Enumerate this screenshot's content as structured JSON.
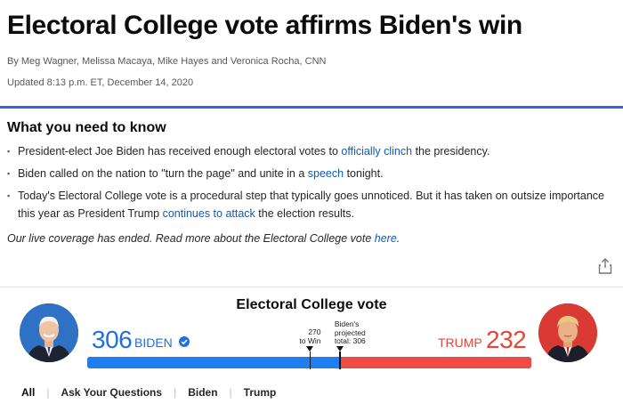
{
  "article": {
    "headline": "Electoral College vote affirms Biden's win",
    "byline": "By Meg Wagner, Melissa Macaya, Mike Hayes and Veronica Rocha, CNN",
    "updated": "Updated 8:13 p.m. ET, December 14, 2020"
  },
  "need_to_know": {
    "title": "What you need to know",
    "points": [
      {
        "before": "President-elect Joe Biden has received enough electoral votes to ",
        "link": "officially clinch",
        "after": " the presidency."
      },
      {
        "before": "Biden called on the nation to \"turn the page\" and unite in a ",
        "link": "speech",
        "after": " tonight."
      },
      {
        "before": "Today's Electoral College vote is a procedural step that typically goes unnoticed. But it has taken on outsize importance this year as President Trump ",
        "link": "continues to attack",
        "after": " the election results."
      }
    ],
    "coverage_before": "Our live coverage has ended. Read more about the Electoral College vote ",
    "coverage_link": "here",
    "coverage_after": "."
  },
  "electoral": {
    "title": "Electoral College vote",
    "total": 538,
    "biden": {
      "votes": "306",
      "name": "BIDEN",
      "value": 306,
      "color": "#1f7ef0"
    },
    "trump": {
      "votes": "232",
      "name": "TRUMP",
      "value": 232,
      "color": "#f04a46"
    },
    "to_win": {
      "value": 270,
      "line1": "270",
      "line2": "to Win"
    },
    "projected": {
      "value": 306,
      "line1": "Biden's",
      "line2": "projected",
      "line3": "total: 306"
    }
  },
  "tabs": [
    "All",
    "Ask Your Questions",
    "Biden",
    "Trump"
  ],
  "icons": {
    "share": "share-icon",
    "check": "verified-check-icon"
  }
}
